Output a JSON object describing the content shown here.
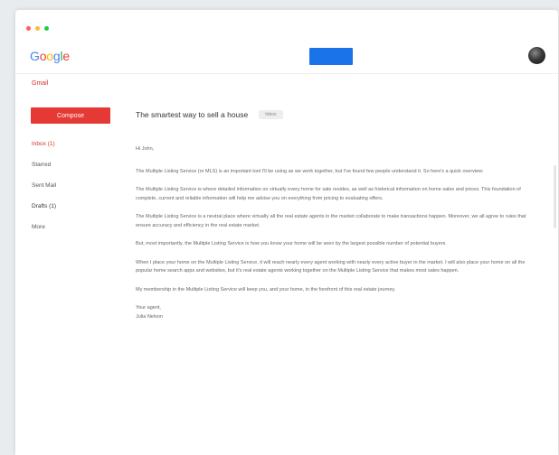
{
  "window": {
    "dots": [
      "#ff5f57",
      "#febc2e",
      "#28c840"
    ]
  },
  "header": {
    "logo": [
      {
        "ch": "G",
        "color": "#4285f4"
      },
      {
        "ch": "o",
        "color": "#ea4335"
      },
      {
        "ch": "o",
        "color": "#fbbc05"
      },
      {
        "ch": "g",
        "color": "#4285f4"
      },
      {
        "ch": "l",
        "color": "#34a853"
      },
      {
        "ch": "e",
        "color": "#ea4335"
      }
    ],
    "accent": "#1a73e8"
  },
  "sidebar": {
    "app_label": "Gmail",
    "compose_label": "Compose",
    "items": [
      {
        "label": "Inbox (1)",
        "state": "active"
      },
      {
        "label": "Starred",
        "state": "normal"
      },
      {
        "label": "Sent Mail",
        "state": "normal"
      },
      {
        "label": "Drafts (1)",
        "state": "bold"
      },
      {
        "label": "More",
        "state": "normal"
      }
    ]
  },
  "email": {
    "subject": "The smartest way to sell a house",
    "tag": "Inbox",
    "greeting": "Hi John,",
    "paragraphs": [
      "The Multiple Listing Service (or MLS) is an important tool I'll be using as we work together, but I've found few people understand it. So here's a quick overview:",
      "The Multiple Listing Service is where detailed information on virtually every home for sale resides, as well as historical information on home sales and prices. This foundation of complete, current and reliable information will help me advise you on everything from pricing to evaluating offers.",
      "The Multiple Listing Service is a neutral place where virtually all the real estate agents in the market collaborate to make transactions happen. Moreover, we all agree to rules that ensure accuracy and efficiency in the real estate market.",
      "But, most importantly, the Multiple Listing Service is how you know your home will be seen by the largest possible number of potential buyers.",
      "When I place your home on the Multiple Listing Service, it will reach nearly every agent working with nearly every active buyer in the market. I will also place your home on all the popular home search apps and websites, but it's real estate agents working together on the Multiple Listing Service that makes most sales happen.",
      "My membership in the Multiple Listing Service will keep you, and your home, in the forefront of this real estate journey."
    ],
    "closing": "Your agent,",
    "signature": "Julia Nelson"
  }
}
